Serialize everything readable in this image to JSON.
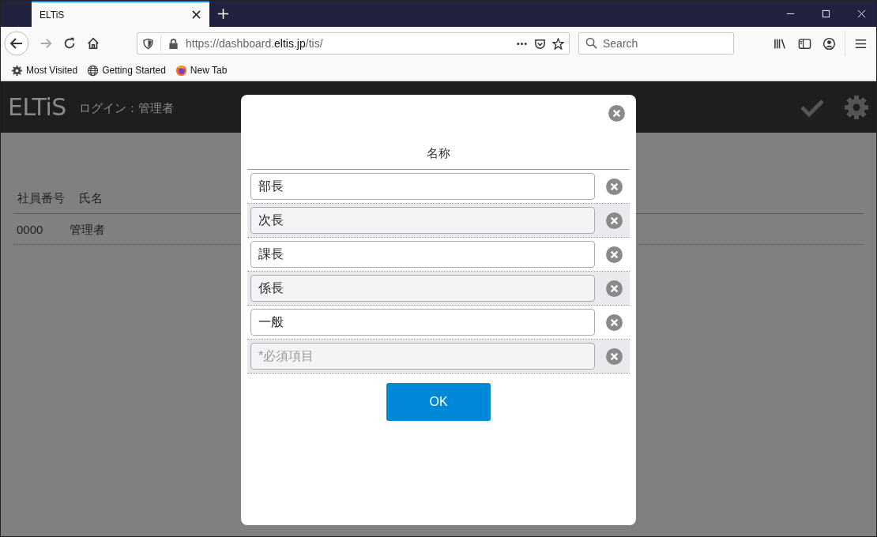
{
  "browser": {
    "tab": {
      "title": "ELTiS"
    },
    "url_parts": [
      {
        "text": "https://dashboard.",
        "emphasis": false
      },
      {
        "text": "eltis.jp",
        "emphasis": true
      },
      {
        "text": "/tis/",
        "emphasis": false
      }
    ],
    "search": {
      "placeholder": "Search"
    },
    "bookmarks": [
      {
        "label": "Most Visited",
        "kind": "gear"
      },
      {
        "label": "Getting Started",
        "kind": "globe"
      },
      {
        "label": "New Tab",
        "kind": "browser"
      }
    ]
  },
  "app": {
    "logo": "ELTiS",
    "login": "ログイン：管理者"
  },
  "table": {
    "columns": [
      "社員番号",
      "氏名"
    ],
    "rows": [
      [
        "0000",
        "管理者"
      ]
    ]
  },
  "dialog": {
    "column": "名称",
    "rows": [
      {
        "value": "部長"
      },
      {
        "value": "次長"
      },
      {
        "value": "課長"
      },
      {
        "value": "係長"
      },
      {
        "value": "一般"
      },
      {
        "placeholder": "*必須項目"
      }
    ],
    "ok": "OK"
  }
}
